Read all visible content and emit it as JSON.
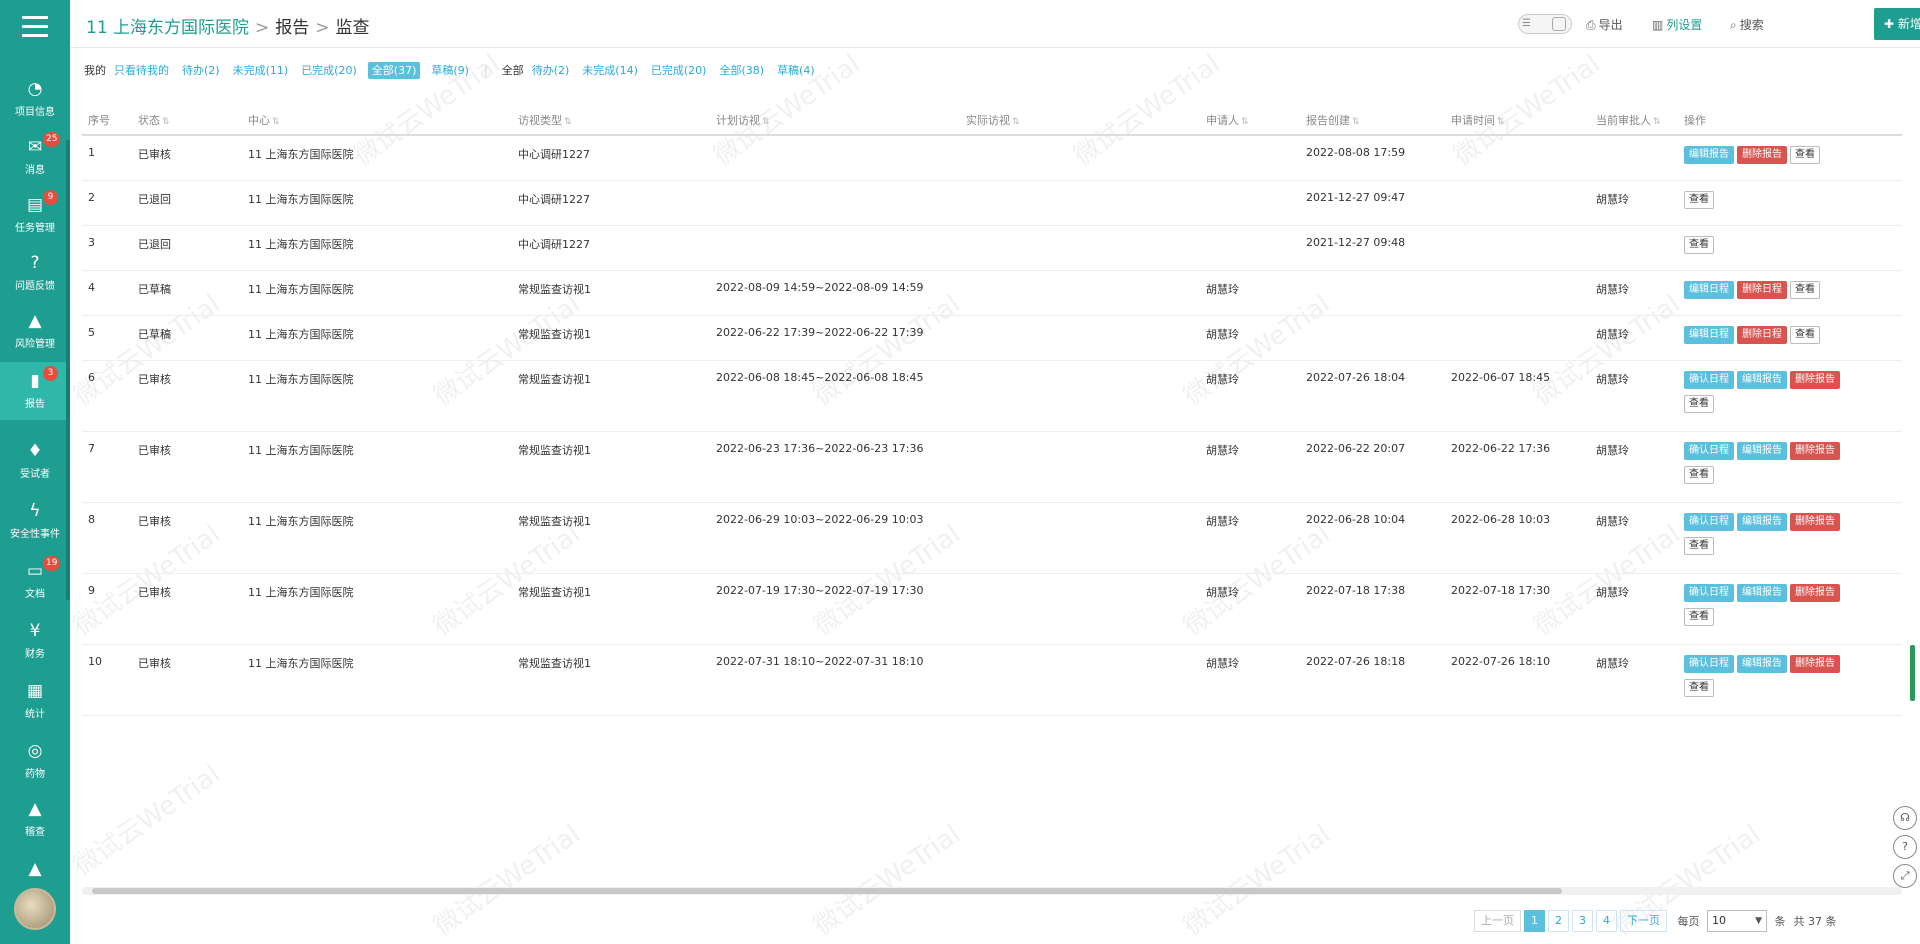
{
  "nav": {
    "items": [
      {
        "label": "项目信息",
        "icon": "pie-chart-icon",
        "glyph": "◔",
        "badge": ""
      },
      {
        "label": "消息",
        "icon": "envelope-icon",
        "glyph": "✉",
        "badge": "25"
      },
      {
        "label": "任务管理",
        "icon": "calendar-icon",
        "glyph": "▤",
        "badge": "9"
      },
      {
        "label": "问题反馈",
        "icon": "question-circle-icon",
        "glyph": "?",
        "badge": ""
      },
      {
        "label": "风险管理",
        "icon": "warning-icon",
        "glyph": "▲",
        "badge": ""
      },
      {
        "label": "报告",
        "icon": "file-report-icon",
        "glyph": "▮",
        "badge": "3"
      },
      {
        "label": "受试者",
        "icon": "subject-icon",
        "glyph": "♦",
        "badge": ""
      },
      {
        "label": "安全性事件",
        "icon": "lightning-icon",
        "glyph": "ϟ",
        "badge": ""
      },
      {
        "label": "文档",
        "icon": "folder-icon",
        "glyph": "▭",
        "badge": "19"
      },
      {
        "label": "财务",
        "icon": "yen-icon",
        "glyph": "¥",
        "badge": ""
      },
      {
        "label": "统计",
        "icon": "bar-chart-icon",
        "glyph": "▦",
        "badge": ""
      },
      {
        "label": "药物",
        "icon": "globe-icon",
        "glyph": "◎",
        "badge": ""
      },
      {
        "label": "稽查",
        "icon": "inspection-icon",
        "glyph": "▲",
        "badge": ""
      },
      {
        "label": "",
        "icon": "more-icon",
        "glyph": "▲",
        "badge": ""
      }
    ]
  },
  "breadcrumb": {
    "center": "11 上海东方国际医院",
    "section": "报告",
    "current": "监查",
    "sep": ">"
  },
  "toolbar": {
    "export": "导出",
    "settings": "列设置",
    "search": "搜索",
    "new": "新增",
    "new_dd": "▾"
  },
  "filters": {
    "mine_label": "我的",
    "mine": [
      {
        "label": "只看待我的",
        "active": false
      },
      {
        "label": "待办(2)",
        "active": false
      },
      {
        "label": "未完成(11)",
        "active": false
      },
      {
        "label": "已完成(20)",
        "active": false
      },
      {
        "label": "全部(37)",
        "active": true
      },
      {
        "label": "草稿(9)",
        "active": false
      }
    ],
    "all_label": "全部",
    "all": [
      {
        "label": "待办(2)",
        "active": false
      },
      {
        "label": "未完成(14)",
        "active": false
      },
      {
        "label": "已完成(20)",
        "active": false
      },
      {
        "label": "全部(38)",
        "active": false
      },
      {
        "label": "草稿(4)",
        "active": false
      }
    ]
  },
  "table": {
    "headers": [
      "序号",
      "状态",
      "中心",
      "访视类型",
      "计划访视",
      "实际访视",
      "申请人",
      "报告创建",
      "申请时间",
      "当前审批人",
      "操作"
    ],
    "rows": [
      {
        "no": "1",
        "status": "已审核",
        "center": "11 上海东方国际医院",
        "type": "中心调研1227",
        "plan": "",
        "actual": "",
        "applicant": "",
        "created": "2022-08-08 17:59",
        "applied": "",
        "approver": "",
        "ops": [
          {
            "label": "编辑报告",
            "kind": "blue"
          },
          {
            "label": "删除报告",
            "kind": "red"
          },
          {
            "label": "查看",
            "kind": "plain"
          }
        ]
      },
      {
        "no": "2",
        "status": "已退回",
        "center": "11 上海东方国际医院",
        "type": "中心调研1227",
        "plan": "",
        "actual": "",
        "applicant": "",
        "created": "2021-12-27 09:47",
        "applied": "",
        "approver": "胡慧玲",
        "ops": [
          {
            "label": "查看",
            "kind": "plain"
          }
        ]
      },
      {
        "no": "3",
        "status": "已退回",
        "center": "11 上海东方国际医院",
        "type": "中心调研1227",
        "plan": "",
        "actual": "",
        "applicant": "",
        "created": "2021-12-27 09:48",
        "applied": "",
        "approver": "",
        "ops": [
          {
            "label": "查看",
            "kind": "plain"
          }
        ]
      },
      {
        "no": "4",
        "status": "已草稿",
        "center": "11 上海东方国际医院",
        "type": "常规监查访视1",
        "plan": "2022-08-09 14:59~2022-08-09 14:59",
        "actual": "",
        "applicant": "胡慧玲",
        "created": "",
        "applied": "",
        "approver": "胡慧玲",
        "ops": [
          {
            "label": "编辑日程",
            "kind": "blue"
          },
          {
            "label": "删除日程",
            "kind": "red"
          },
          {
            "label": "查看",
            "kind": "plain"
          }
        ]
      },
      {
        "no": "5",
        "status": "已草稿",
        "center": "11 上海东方国际医院",
        "type": "常规监查访视1",
        "plan": "2022-06-22 17:39~2022-06-22 17:39",
        "actual": "",
        "applicant": "胡慧玲",
        "created": "",
        "applied": "",
        "approver": "胡慧玲",
        "ops": [
          {
            "label": "编辑日程",
            "kind": "blue"
          },
          {
            "label": "删除日程",
            "kind": "red"
          },
          {
            "label": "查看",
            "kind": "plain"
          }
        ]
      },
      {
        "no": "6",
        "status": "已审核",
        "center": "11 上海东方国际医院",
        "type": "常规监查访视1",
        "plan": "2022-06-08 18:45~2022-06-08 18:45",
        "actual": "",
        "applicant": "胡慧玲",
        "created": "2022-07-26 18:04",
        "applied": "2022-06-07 18:45",
        "approver": "胡慧玲",
        "ops": [
          {
            "label": "确认日程",
            "kind": "blue"
          },
          {
            "label": "编辑报告",
            "kind": "blue"
          },
          {
            "label": "删除报告",
            "kind": "red"
          },
          {
            "label": "查看",
            "kind": "plain"
          }
        ]
      },
      {
        "no": "7",
        "status": "已审核",
        "center": "11 上海东方国际医院",
        "type": "常规监查访视1",
        "plan": "2022-06-23 17:36~2022-06-23 17:36",
        "actual": "",
        "applicant": "胡慧玲",
        "created": "2022-06-22 20:07",
        "applied": "2022-06-22 17:36",
        "approver": "胡慧玲",
        "ops": [
          {
            "label": "确认日程",
            "kind": "blue"
          },
          {
            "label": "编辑报告",
            "kind": "blue"
          },
          {
            "label": "删除报告",
            "kind": "red"
          },
          {
            "label": "查看",
            "kind": "plain"
          }
        ]
      },
      {
        "no": "8",
        "status": "已审核",
        "center": "11 上海东方国际医院",
        "type": "常规监查访视1",
        "plan": "2022-06-29 10:03~2022-06-29 10:03",
        "actual": "",
        "applicant": "胡慧玲",
        "created": "2022-06-28 10:04",
        "applied": "2022-06-28 10:03",
        "approver": "胡慧玲",
        "ops": [
          {
            "label": "确认日程",
            "kind": "blue"
          },
          {
            "label": "编辑报告",
            "kind": "blue"
          },
          {
            "label": "删除报告",
            "kind": "red"
          },
          {
            "label": "查看",
            "kind": "plain"
          }
        ]
      },
      {
        "no": "9",
        "status": "已审核",
        "center": "11 上海东方国际医院",
        "type": "常规监查访视1",
        "plan": "2022-07-19 17:30~2022-07-19 17:30",
        "actual": "",
        "applicant": "胡慧玲",
        "created": "2022-07-18 17:38",
        "applied": "2022-07-18 17:30",
        "approver": "胡慧玲",
        "ops": [
          {
            "label": "确认日程",
            "kind": "blue"
          },
          {
            "label": "编辑报告",
            "kind": "blue"
          },
          {
            "label": "删除报告",
            "kind": "red"
          },
          {
            "label": "查看",
            "kind": "plain"
          }
        ]
      },
      {
        "no": "10",
        "status": "已审核",
        "center": "11 上海东方国际医院",
        "type": "常规监查访视1",
        "plan": "2022-07-31 18:10~2022-07-31 18:10",
        "actual": "",
        "applicant": "胡慧玲",
        "created": "2022-07-26 18:18",
        "applied": "2022-07-26 18:10",
        "approver": "胡慧玲",
        "ops": [
          {
            "label": "确认日程",
            "kind": "blue"
          },
          {
            "label": "编辑报告",
            "kind": "blue"
          },
          {
            "label": "删除报告",
            "kind": "red"
          },
          {
            "label": "查看",
            "kind": "plain"
          }
        ]
      }
    ]
  },
  "pager": {
    "prev": "上一页",
    "next": "下一页",
    "pages": [
      "1",
      "2",
      "3",
      "4"
    ],
    "current": "1",
    "per_page_label": "每页",
    "per_page": "10",
    "per_page_unit": "条",
    "total": "共 37 条"
  },
  "watermark": "微试云WeTrial",
  "colors": {
    "sidebar": "#1e9e91",
    "accent": "#1e9e91",
    "link": "#2aa9d9",
    "danger": "#d9534f"
  }
}
